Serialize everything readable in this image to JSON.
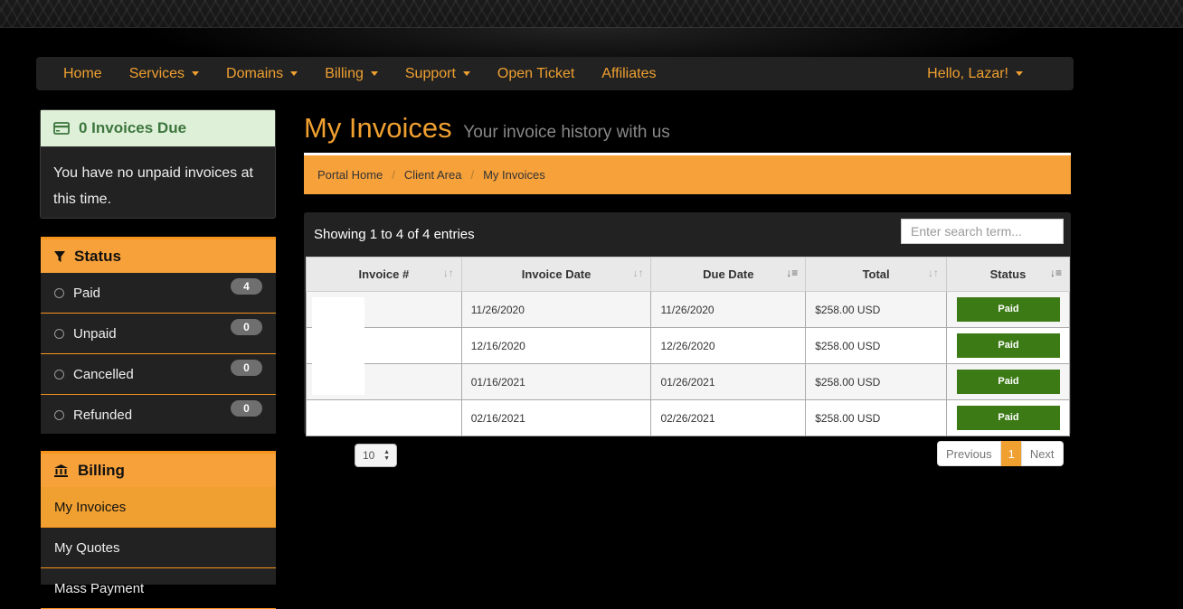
{
  "nav": {
    "home": "Home",
    "services": "Services",
    "domains": "Domains",
    "billing": "Billing",
    "support": "Support",
    "open_ticket": "Open Ticket",
    "affiliates": "Affiliates",
    "user": "Hello, Lazar!"
  },
  "invoices_due": {
    "title": "0 Invoices Due",
    "message": "You have no unpaid invoices at this time."
  },
  "status_panel": {
    "title": "Status",
    "items": [
      {
        "label": "Paid",
        "count": "4"
      },
      {
        "label": "Unpaid",
        "count": "0"
      },
      {
        "label": "Cancelled",
        "count": "0"
      },
      {
        "label": "Refunded",
        "count": "0"
      }
    ]
  },
  "billing_panel": {
    "title": "Billing",
    "items": [
      "My Invoices",
      "My Quotes",
      "Mass Payment"
    ]
  },
  "page": {
    "title": "My Invoices",
    "subtitle": "Your invoice history with us"
  },
  "breadcrumb": [
    "Portal Home",
    "Client Area",
    "My Invoices"
  ],
  "table": {
    "showing": "Showing 1 to 4 of 4 entries",
    "search_placeholder": "Enter search term...",
    "headers": [
      "Invoice #",
      "Invoice Date",
      "Due Date",
      "Total",
      "Status"
    ],
    "rows": [
      {
        "invoice": "",
        "date": "11/26/2020",
        "due": "11/26/2020",
        "total": "$258.00 USD",
        "status": "Paid"
      },
      {
        "invoice": "",
        "date": "12/16/2020",
        "due": "12/26/2020",
        "total": "$258.00 USD",
        "status": "Paid"
      },
      {
        "invoice": "",
        "date": "01/16/2021",
        "due": "01/26/2021",
        "total": "$258.00 USD",
        "status": "Paid"
      },
      {
        "invoice": "",
        "date": "02/16/2021",
        "due": "02/26/2021",
        "total": "$258.00 USD",
        "status": "Paid"
      }
    ]
  },
  "pagination": {
    "page_length": "10",
    "previous": "Previous",
    "current": "1",
    "next": "Next"
  },
  "colors": {
    "accent": "#f0a030",
    "paid_badge": "#3c7a15"
  }
}
